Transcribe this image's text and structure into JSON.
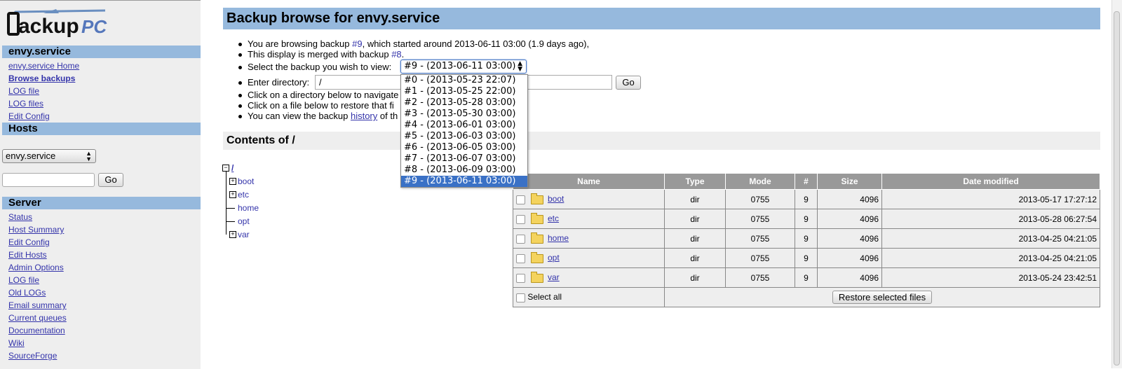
{
  "brand": {
    "name": "BackupPC"
  },
  "sidebar": {
    "host_header": "envy.service",
    "host_links": [
      {
        "label": "envy.service Home",
        "bold": false
      },
      {
        "label": "Browse backups",
        "bold": true
      },
      {
        "label": "LOG file",
        "bold": false
      },
      {
        "label": "LOG files",
        "bold": false
      },
      {
        "label": "Edit Config",
        "bold": false
      }
    ],
    "hosts_header": "Hosts",
    "host_select_value": "envy.service",
    "go_label": "Go",
    "server_header": "Server",
    "server_links": [
      "Status",
      "Host Summary",
      "Edit Config",
      "Edit Hosts",
      "Admin Options",
      "LOG file",
      "Old LOGs",
      "Email summary",
      "Current queues",
      "Documentation",
      "Wiki",
      "SourceForge"
    ]
  },
  "main": {
    "title": "Backup browse for envy.service",
    "info": {
      "line1_pre": "You are browsing backup ",
      "line1_link": "#9",
      "line1_post": ", which started around 2013-06-11 03:00 (1.9 days ago),",
      "line2_pre": "This display is merged with backup ",
      "line2_link": "#8",
      "line2_post": ".",
      "select_label": "Select the backup you wish to view:",
      "select_value": "#9 - (2013-06-11 03:00)",
      "dir_label": "Enter directory:",
      "dir_value": "/",
      "go_label": "Go",
      "line5": "Click on a directory below to navigate",
      "line6": "Click on a file below to restore that fi",
      "line7_pre": "You can view the backup ",
      "line7_link": "history",
      "line7_post": " of th"
    },
    "dropdown_options": [
      "#0 - (2013-05-23 22:07)",
      "#1 - (2013-05-25 22:00)",
      "#2 - (2013-05-28 03:00)",
      "#3 - (2013-05-30 03:00)",
      "#4 - (2013-06-01 03:00)",
      "#5 - (2013-06-03 03:00)",
      "#6 - (2013-06-05 03:00)",
      "#7 - (2013-06-07 03:00)",
      "#8 - (2013-06-09 03:00)",
      "#9 - (2013-06-11 03:00)"
    ],
    "dropdown_selected": 9,
    "contents_title": "Contents of /",
    "tree": {
      "root": "/",
      "items": [
        "boot",
        "etc",
        "home",
        "opt",
        "var"
      ]
    },
    "table": {
      "headers": [
        "Name",
        "Type",
        "Mode",
        "#",
        "Size",
        "Date modified"
      ],
      "rows": [
        {
          "name": "boot",
          "type": "dir",
          "mode": "0755",
          "num": "9",
          "size": "4096",
          "date": "2013-05-17 17:27:12"
        },
        {
          "name": "etc",
          "type": "dir",
          "mode": "0755",
          "num": "9",
          "size": "4096",
          "date": "2013-05-28 06:27:54"
        },
        {
          "name": "home",
          "type": "dir",
          "mode": "0755",
          "num": "9",
          "size": "4096",
          "date": "2013-04-25 04:21:05"
        },
        {
          "name": "opt",
          "type": "dir",
          "mode": "0755",
          "num": "9",
          "size": "4096",
          "date": "2013-04-25 04:21:05"
        },
        {
          "name": "var",
          "type": "dir",
          "mode": "0755",
          "num": "9",
          "size": "4096",
          "date": "2013-05-24 23:42:51"
        }
      ],
      "select_all": "Select all",
      "restore_label": "Restore selected files"
    }
  },
  "colors": {
    "header_blue": "#96b9dd",
    "link": "#3333aa",
    "sidebar_bg": "#eeeeee",
    "table_head": "#999999",
    "selected_option": "#3a71c6"
  }
}
